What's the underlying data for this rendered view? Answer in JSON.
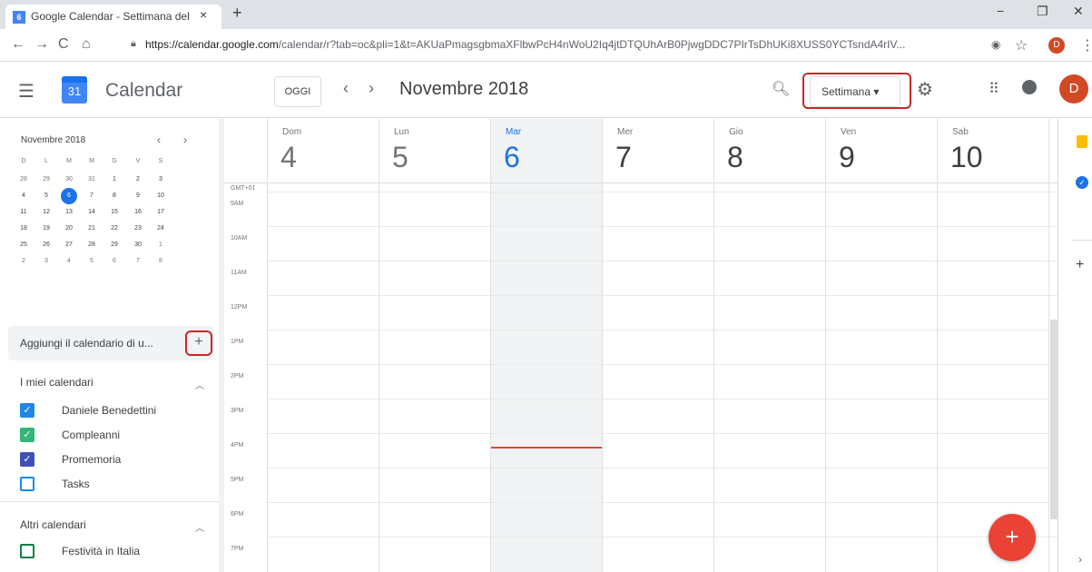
{
  "browser": {
    "tab_title": "Google Calendar - Settimana del",
    "tab_icon": "6",
    "new_tab": "+",
    "close_tab": "×",
    "url_host": "https://calendar.google.com",
    "url_path": "/calendar/r?tab=oc&pli=1&t=AKUaPmagsgbmaXFlbwPcH4nWoU2Iq4jtDTQUhArB0PjwgDDC7PIrTsDhUKi8XUSS0YCTsndA4rIV...",
    "profile_initial": "D",
    "min": "−",
    "max": "❐",
    "close": "✕"
  },
  "header": {
    "app_name": "Calendar",
    "logo_day": "31",
    "today_label": "OGGI",
    "prev": "‹",
    "next": "›",
    "month_label": "Novembre 2018",
    "view_label": "Settimana ▾",
    "avatar_initial": "D"
  },
  "mini_calendar": {
    "title": "Novembre 2018",
    "prev": "‹",
    "next": "›",
    "weekday_heads": [
      "D",
      "L",
      "M",
      "M",
      "G",
      "V",
      "S"
    ],
    "weeks": [
      [
        "28",
        "29",
        "30",
        "31",
        "1",
        "2",
        "3"
      ],
      [
        "4",
        "5",
        "6",
        "7",
        "8",
        "9",
        "10"
      ],
      [
        "11",
        "12",
        "13",
        "14",
        "15",
        "16",
        "17"
      ],
      [
        "18",
        "19",
        "20",
        "21",
        "22",
        "23",
        "24"
      ],
      [
        "25",
        "26",
        "27",
        "28",
        "29",
        "30",
        "1"
      ],
      [
        "2",
        "3",
        "4",
        "5",
        "6",
        "7",
        "8"
      ]
    ],
    "today": "6"
  },
  "sidebar": {
    "add_calendar_placeholder": "Aggiungi il calendario di u...",
    "add_button": "+",
    "my_calendars_title": "I miei calendari",
    "my_calendars": [
      {
        "label": "Daniele Benedettini",
        "color": "#1e88e5",
        "checked": true
      },
      {
        "label": "Compleanni",
        "color": "#33b679",
        "checked": true
      },
      {
        "label": "Promemoria",
        "color": "#3f51b5",
        "checked": true
      },
      {
        "label": "Tasks",
        "color": "#1e88e5",
        "checked": false
      }
    ],
    "other_calendars_title": "Altri calendari",
    "other_calendars": [
      {
        "label": "Festività in Italia",
        "color": "#0b8043",
        "checked": false
      }
    ]
  },
  "week": {
    "timezone": "GMT+01",
    "days": [
      {
        "name": "Dom",
        "date": "4",
        "state": "past"
      },
      {
        "name": "Lun",
        "date": "5",
        "state": "past"
      },
      {
        "name": "Mar",
        "date": "6",
        "state": "today"
      },
      {
        "name": "Mer",
        "date": "7",
        "state": "future"
      },
      {
        "name": "Gio",
        "date": "8",
        "state": "future"
      },
      {
        "name": "Ven",
        "date": "9",
        "state": "future"
      },
      {
        "name": "Sab",
        "date": "10",
        "state": "future"
      }
    ],
    "hours": [
      "9AM",
      "10AM",
      "11AM",
      "12PM",
      "1PM",
      "2PM",
      "3PM",
      "4PM",
      "5PM",
      "6PM",
      "7PM"
    ],
    "now_time": "4PM",
    "create_button": "+"
  },
  "colors": {
    "accent": "#1a73e8",
    "fab": "#ea4335",
    "highlight": "#c62828"
  },
  "icons": [
    "menu-icon",
    "calendar-logo-icon",
    "search-icon",
    "settings-icon",
    "apps-icon",
    "notifications-icon",
    "keep-icon",
    "tasks-icon"
  ]
}
